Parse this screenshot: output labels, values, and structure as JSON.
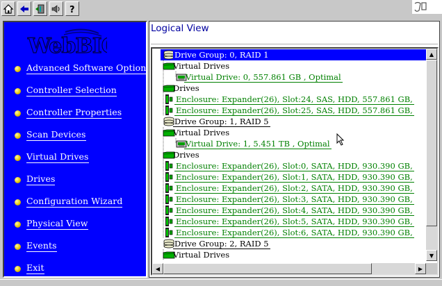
{
  "toolbar": {
    "buttons": [
      {
        "icon": "home-icon"
      },
      {
        "icon": "back-arrow-icon"
      },
      {
        "icon": "exit-door-icon"
      },
      {
        "icon": "speaker-icon"
      },
      {
        "icon": "help-icon"
      }
    ]
  },
  "left_panel": {
    "brand_text": "WebBIOS",
    "menu": [
      {
        "label": "Advanced Software Options"
      },
      {
        "label": "Controller Selection"
      },
      {
        "label": "Controller Properties"
      },
      {
        "label": "Scan Devices"
      },
      {
        "label": "Virtual Drives"
      },
      {
        "label": "Drives"
      },
      {
        "label": "Configuration Wizard"
      },
      {
        "label": "Physical View"
      },
      {
        "label": "Events"
      },
      {
        "label": "Exit"
      }
    ]
  },
  "main": {
    "title": "Logical View",
    "tree": [
      {
        "label": "Drive Group: 0, RAID 1",
        "type": "drive-group",
        "level": 0,
        "selected": true
      },
      {
        "label": "Virtual Drives",
        "type": "folder",
        "level": 1
      },
      {
        "label": "Virtual Drive: 0, 557.861 GB , Optimal",
        "type": "virtual-drive",
        "level": 2
      },
      {
        "label": "Drives",
        "type": "folder",
        "level": 1
      },
      {
        "label": "Enclosure: Expander(26), Slot:24, SAS, HDD, 557.861 GB,",
        "type": "drive",
        "level": 1
      },
      {
        "label": "Enclosure: Expander(26), Slot:25, SAS, HDD, 557.861 GB,",
        "type": "drive",
        "level": 1
      },
      {
        "label": "Drive Group: 1, RAID 5",
        "type": "drive-group",
        "level": 0
      },
      {
        "label": "Virtual Drives",
        "type": "folder",
        "level": 1
      },
      {
        "label": "Virtual Drive: 1, 5.451 TB , Optimal",
        "type": "virtual-drive",
        "level": 2
      },
      {
        "label": "Drives",
        "type": "folder",
        "level": 1
      },
      {
        "label": "Enclosure: Expander(26), Slot:0, SATA, HDD, 930.390 GB,",
        "type": "drive",
        "level": 1
      },
      {
        "label": "Enclosure: Expander(26), Slot:1, SATA, HDD, 930.390 GB,",
        "type": "drive",
        "level": 1
      },
      {
        "label": "Enclosure: Expander(26), Slot:2, SATA, HDD, 930.390 GB,",
        "type": "drive",
        "level": 1
      },
      {
        "label": "Enclosure: Expander(26), Slot:3, SATA, HDD, 930.390 GB,",
        "type": "drive",
        "level": 1
      },
      {
        "label": "Enclosure: Expander(26), Slot:4, SATA, HDD, 930.390 GB,",
        "type": "drive",
        "level": 1
      },
      {
        "label": "Enclosure: Expander(26), Slot:5, SATA, HDD, 930.390 GB,",
        "type": "drive",
        "level": 1
      },
      {
        "label": "Enclosure: Expander(26), Slot:6, SATA, HDD, 930.390 GB,",
        "type": "drive",
        "level": 1
      },
      {
        "label": "Drive Group: 2, RAID 5",
        "type": "drive-group",
        "level": 0
      },
      {
        "label": "Virtual Drives",
        "type": "folder",
        "level": 1
      }
    ]
  },
  "colors": {
    "panel_blue": "#0000ff",
    "selection": "#0000ff",
    "link_green": "#008000",
    "bullet_yellow": "#e0c000"
  }
}
